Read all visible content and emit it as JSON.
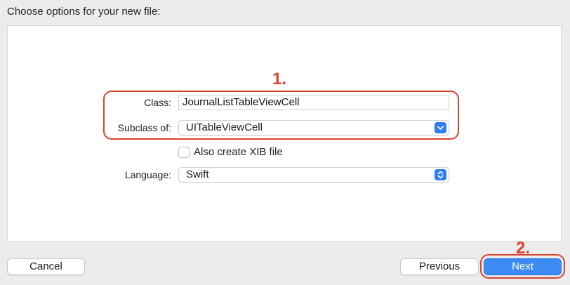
{
  "header": {
    "title": "Choose options for your new file:"
  },
  "form": {
    "class_label": "Class:",
    "class_value": "JournalListTableViewCell",
    "subclass_label": "Subclass of:",
    "subclass_value": "UITableViewCell",
    "xib_label": "Also create XIB file",
    "xib_checked": false,
    "language_label": "Language:",
    "language_value": "Swift"
  },
  "annotations": {
    "step1": "1.",
    "step2": "2.",
    "color": "#d9442f"
  },
  "footer": {
    "cancel_label": "Cancel",
    "previous_label": "Previous",
    "next_label": "Next"
  },
  "colors": {
    "accent": "#3b8bf3",
    "popup_arrow": "#2e7cf6"
  }
}
